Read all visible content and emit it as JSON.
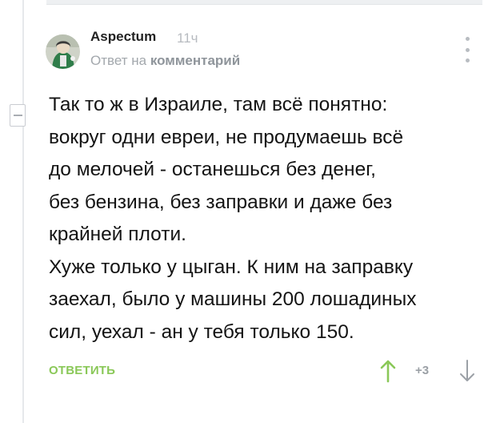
{
  "comment": {
    "author": "Aspectum",
    "time": "11ч",
    "reply_prefix": "Ответ на",
    "reply_link": "комментарий",
    "lines": [
      "Так то ж в Израиле, там всё понятно:",
      "вокруг одни евреи, не продумаешь всё",
      "до мелочей - останешься без денег,",
      "без бензина, без заправки и даже без",
      "крайней плоти.",
      "Хуже только у цыган. К ним на заправку",
      "заехал, было у машины 200 лошадиных",
      "сил, уехал - ан у тебя только 150."
    ],
    "reply_label": "ОТВЕТИТЬ",
    "rating": "+3"
  },
  "icons": {
    "collapse": "minus-icon",
    "menu": "more-vertical-icon",
    "upvote": "arrow-up-icon",
    "downvote": "arrow-down-icon"
  },
  "colors": {
    "accent_green": "#8ac858",
    "muted_gray": "#a3a8ad",
    "thread_line": "#e6e8eb"
  }
}
